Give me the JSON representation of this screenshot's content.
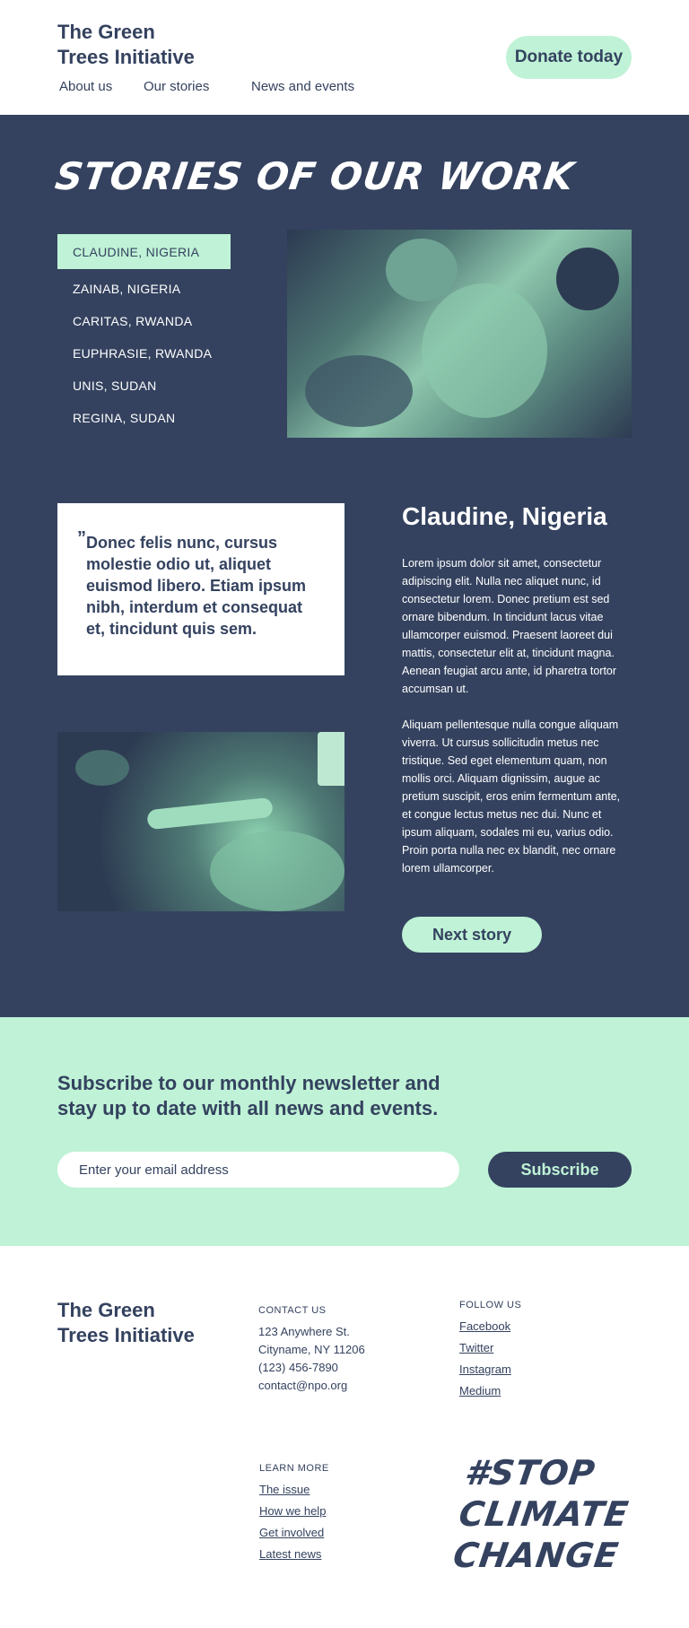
{
  "header": {
    "logo_line1": "The Green",
    "logo_line2": "Trees Initiative",
    "donate_label": "Donate today",
    "nav": [
      "About us",
      "Our stories",
      "News and events"
    ]
  },
  "stories": {
    "title": "STORIES OF OUR WORK",
    "list": [
      "CLAUDINE, NIGERIA",
      "ZAINAB, NIGERIA",
      "CARITAS, RWANDA",
      "EUPHRASIE, RWANDA",
      "UNIS, SUDAN",
      "REGINA, SUDAN"
    ],
    "quote_mark": "”",
    "quote": "Donec felis nunc, cursus molestie odio ut, aliquet euismod libero. Etiam ipsum nibh, interdum et consequat et, tincidunt quis sem.",
    "name": "Claudine, Nigeria",
    "paragraph1": "Lorem ipsum dolor sit amet, consectetur adipiscing elit. Nulla nec aliquet nunc, id consectetur lorem. Donec pretium est sed ornare bibendum. In tincidunt lacus vitae ullamcorper euismod. Praesent laoreet dui mattis, consectetur elit at, tincidunt magna. Aenean feugiat arcu ante, id pharetra tortor accumsan ut.",
    "paragraph2": "Aliquam pellentesque nulla congue aliquam viverra. Ut cursus sollicitudin metus nec tristique. Sed eget elementum quam, non mollis orci. Aliquam dignissim, augue ac pretium suscipit, eros enim fermentum ante, et congue lectus metus nec dui. Nunc et ipsum aliquam, sodales mi eu, varius odio. Proin porta nulla nec ex blandit, nec ornare lorem ullamcorper.",
    "next_label": "Next story"
  },
  "newsletter": {
    "title": "Subscribe to our monthly newsletter and stay up to date with all news and events.",
    "placeholder": "Enter your email address",
    "subscribe_label": "Subscribe"
  },
  "footer": {
    "logo_line1": "The Green",
    "logo_line2": "Trees Initiative",
    "contact_head": "CONTACT US",
    "address1": "123 Anywhere St.",
    "address2": "Cityname, NY 11206",
    "phone": "(123) 456-7890",
    "email": "contact@npo.org",
    "follow_head": "FOLLOW US",
    "follow": [
      "Facebook",
      "Twitter",
      "Instagram",
      "Medium"
    ],
    "learn_head": "LEARN MORE",
    "learn": [
      "The issue",
      "How we help",
      "Get involved",
      "Latest news"
    ],
    "slogan1": "#STOP",
    "slogan2": "CLIMATE",
    "slogan3": "CHANGE"
  },
  "colors": {
    "navy": "#34425f",
    "mint": "#bff2d6",
    "white": "#ffffff"
  }
}
